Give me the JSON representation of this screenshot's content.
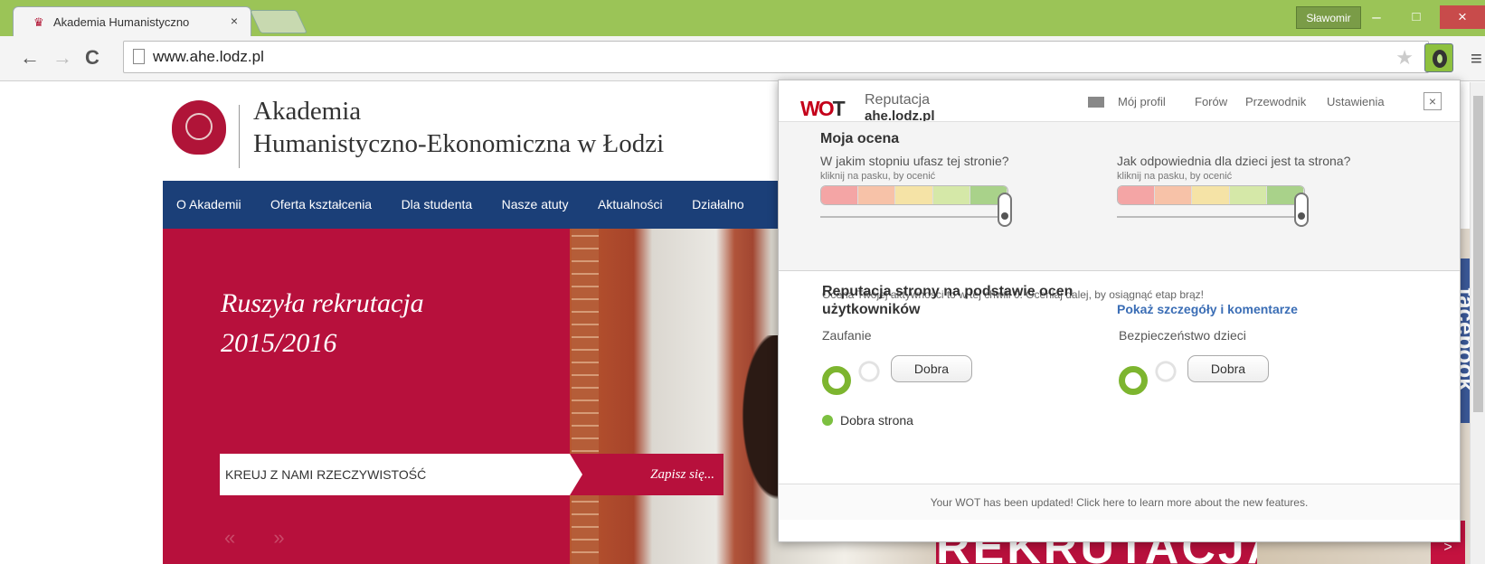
{
  "browser": {
    "tab_title": "Akademia Humanistyczno",
    "tab_close": "×",
    "user": "Sławomir",
    "minimize": "–",
    "maximize": "□",
    "close": "×",
    "back": "←",
    "forward": "→",
    "reload": "C",
    "url": "www.ahe.lodz.pl",
    "star": "★",
    "menu": "≡"
  },
  "site": {
    "uni_line1": "Akademia",
    "uni_line2": "Humanistyczno-Ekonomiczna w Łodzi",
    "nav": [
      "O Akademii",
      "Oferta kształcenia",
      "Dla studenta",
      "Nasze atuty",
      "Aktualności",
      "Działalno"
    ],
    "hero_line1": "Ruszyła rekrutacja",
    "hero_line2": "2015/2016",
    "kreuj": "KREUJ Z NAMI RZECZYWISTOŚĆ",
    "zapisz": "Zapisz się...",
    "arrows": "« »",
    "rekrutacja": "REKRUTACJA",
    "facebook": "facebook",
    "next_arrow": ">"
  },
  "wot": {
    "logo_w": "WO",
    "logo_t": "T",
    "reputacja": "Reputacja",
    "domain": "ahe.lodz.pl",
    "links": [
      "Mój profil",
      "Forów",
      "Przewodnik",
      "Ustawienia"
    ],
    "close": "×",
    "my_rating": "Moja ocena",
    "q_trust": "W jakim stopniu ufasz tej stronie?",
    "q_child": "Jak odpowiednia dla dzieci jest ta strona?",
    "hint": "kliknij na pasku, by ocenić",
    "activity": "Ocena Twojej aktywności to w tej chwili 0. Oceniaj dalej, by osiągnąć etap brąz!",
    "rep_title_1": "Reputacja strony na podstawie ocen",
    "rep_title_2": "użytkowników",
    "details_link": "Pokaż szczegóły i komentarze",
    "trust": "Zaufanie",
    "child": "Bezpieczeństwo dzieci",
    "rating_trust": "Dobra",
    "rating_child": "Dobra",
    "good_site": "Dobra strona",
    "footer": "Your WOT has been updated! Click here to learn more about the new features.",
    "colors": {
      "accent": "#c4001a",
      "good": "#7db52f",
      "link": "#3a6db5"
    }
  }
}
